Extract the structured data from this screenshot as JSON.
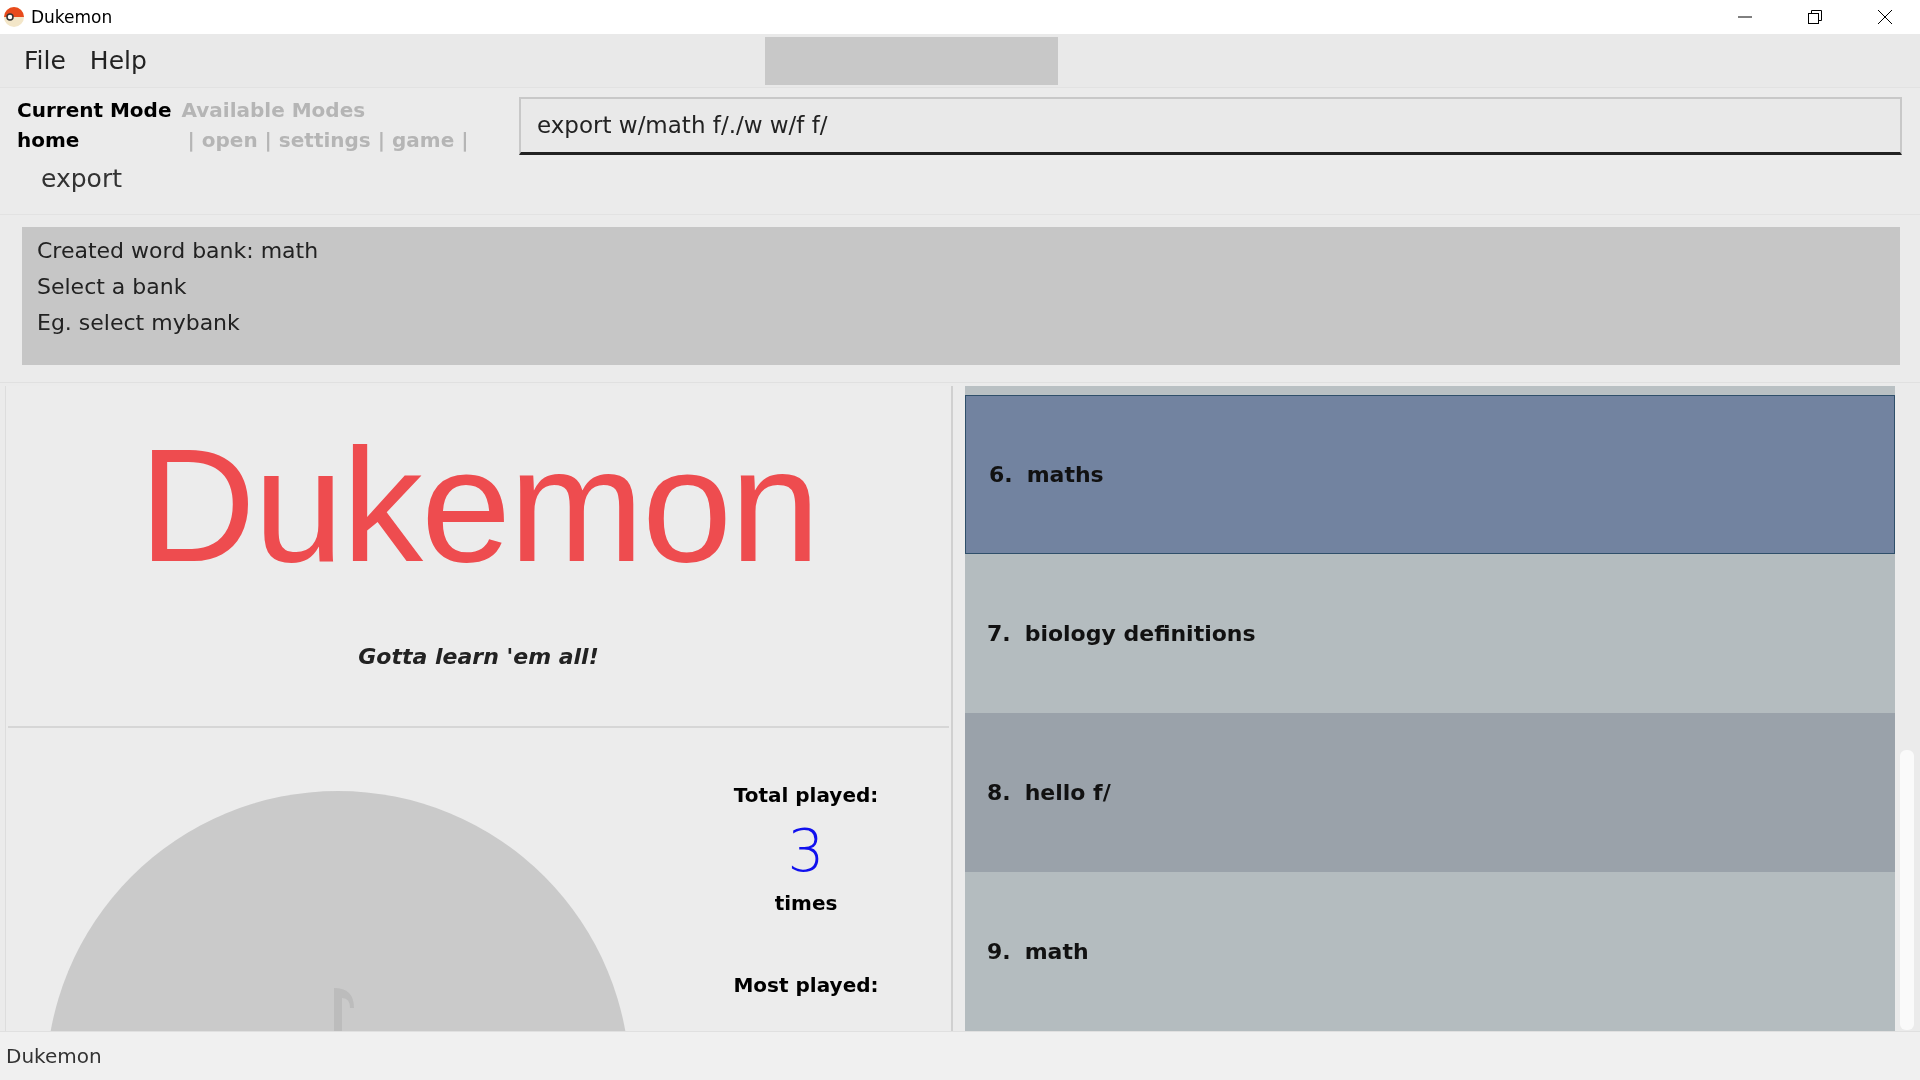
{
  "window": {
    "title": "Dukemon"
  },
  "menu": [
    {
      "label": "File"
    },
    {
      "label": "Help"
    }
  ],
  "mode": {
    "current_label": "Current Mode",
    "current": "home",
    "available_label": "Available Modes",
    "available": "| open | settings | game |"
  },
  "suggestion": "export",
  "command": {
    "value": "export w/math f/./w w/f f/"
  },
  "result": [
    "Created word bank: math",
    "Select a bank",
    "Eg. select mybank"
  ],
  "logo": {
    "text": "Dukemon",
    "tagline": "Gotta learn 'em all!"
  },
  "stats": {
    "total_label": "Total played:",
    "total": "3",
    "unit": "times",
    "most_label": "Most played:"
  },
  "banks": [
    {
      "index": "6.",
      "name": "maths",
      "selected": true
    },
    {
      "index": "7.",
      "name": "biology definitions",
      "selected": false
    },
    {
      "index": "8.",
      "name": "hello f/",
      "selected": false
    },
    {
      "index": "9.",
      "name": "math",
      "selected": false
    }
  ],
  "status_bar": "Dukemon"
}
